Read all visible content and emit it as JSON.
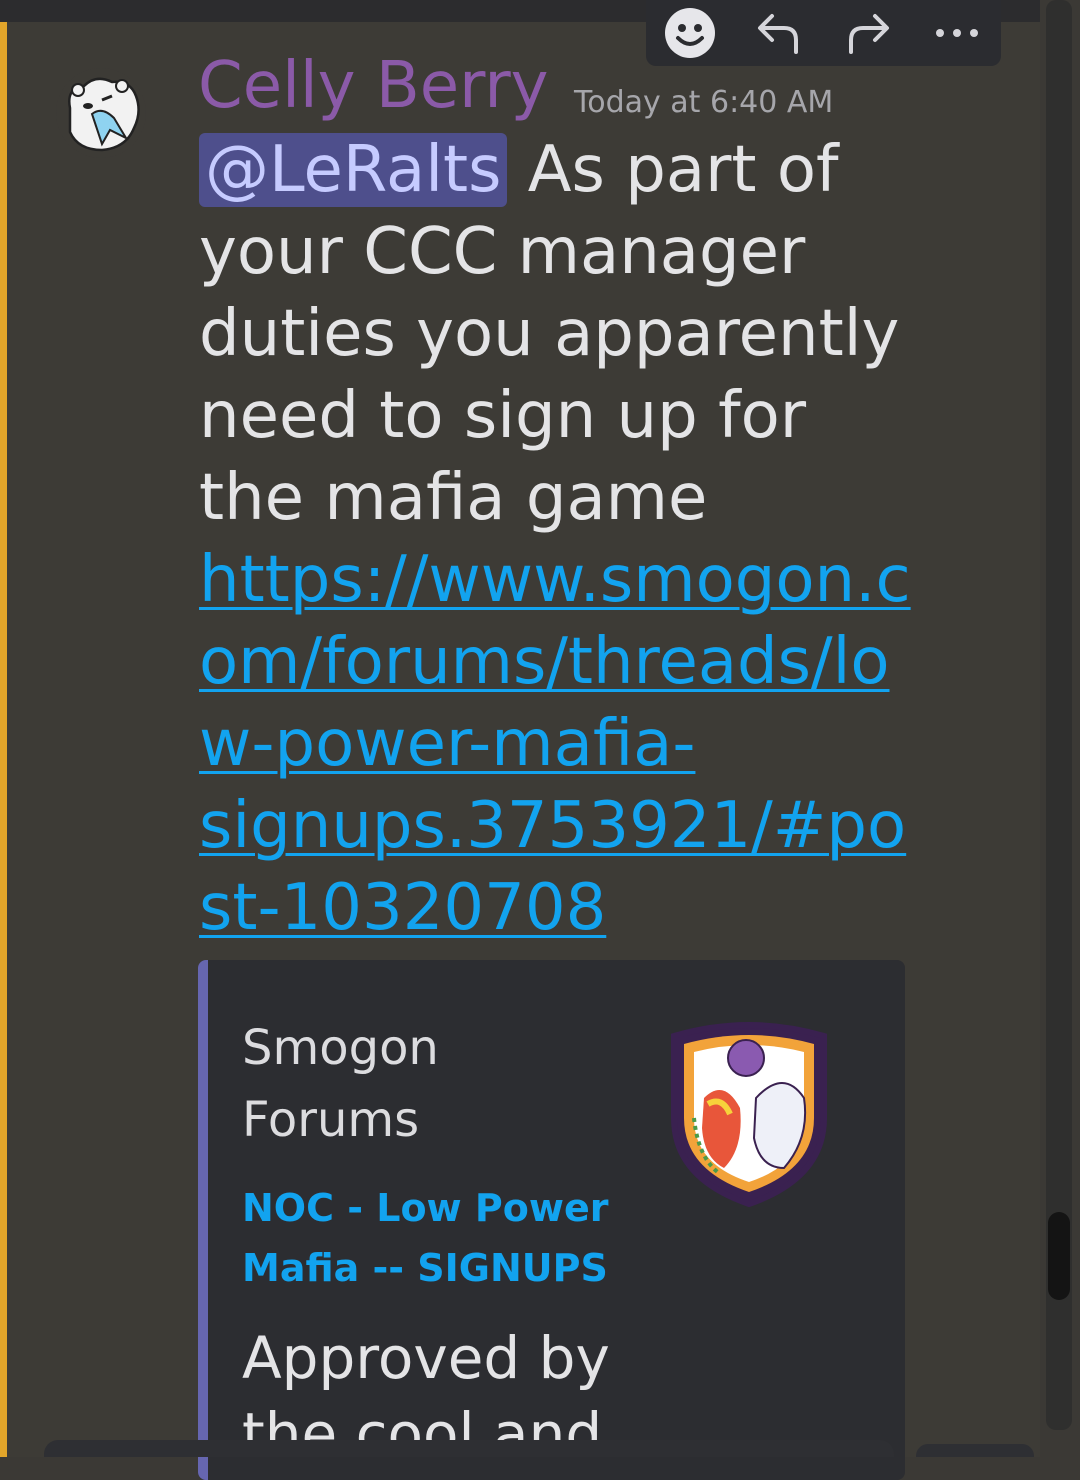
{
  "message": {
    "author": "Celly Berry",
    "timestamp": "Today at 6:40 AM",
    "mention": "@LeRalts",
    "text": " As part of your CCC manager duties you apparently need to sign up for the mafia game ",
    "link": "https://www.smogon.com/forums/threads/low-power-mafia-signups.3753921/#post-10320708",
    "author_color": "#8b5aa8",
    "link_color": "#12a3ef",
    "highlight_color": "#e2a52a"
  },
  "toolbar": {
    "icons": [
      "add-reaction-icon",
      "reply-icon",
      "forward-icon",
      "more-icon"
    ]
  },
  "embed": {
    "provider": "Smogon Forums",
    "title": "NOC - Low Power Mafia -- SIGNUPS",
    "description": "Approved by the cool and",
    "accent_color": "#6666b0"
  }
}
